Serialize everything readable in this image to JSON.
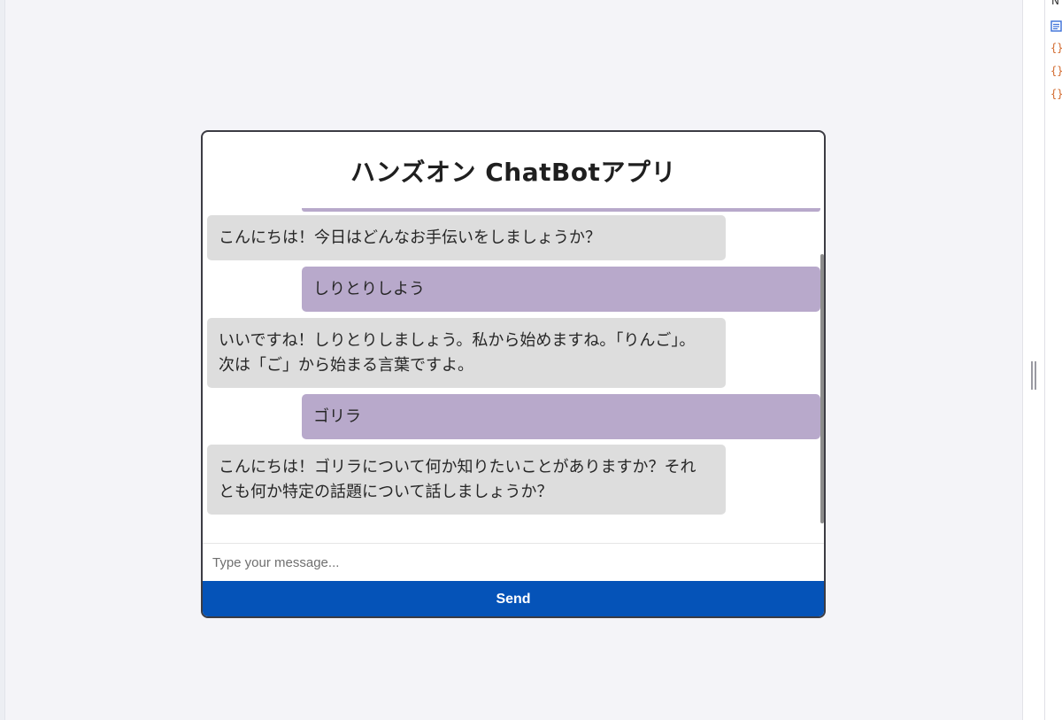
{
  "app": {
    "title": "ハンズオン ChatBotアプリ"
  },
  "messages": [
    {
      "role": "bot",
      "text": "こんにちは！今日はどんなお手伝いをしましょうか？"
    },
    {
      "role": "user",
      "text": "しりとりしよう"
    },
    {
      "role": "bot",
      "lines": [
        "いいですね！しりとりしましょう。私から始めますね。「りんご」。",
        "次は「ご」から始まる言葉ですよ。"
      ]
    },
    {
      "role": "user",
      "text": "ゴリラ"
    },
    {
      "role": "bot",
      "lines": [
        "こんにちは！ゴリラについて何か知りたいことがありますか？それ",
        "とも何か特定の話題について話しましょうか？"
      ]
    }
  ],
  "input": {
    "placeholder": "Type your message...",
    "value": ""
  },
  "send": {
    "label": "Send"
  },
  "devtools": {
    "header_fragment": "N"
  },
  "colors": {
    "bot_bubble": "#dddddd",
    "user_bubble": "#b8a9cb",
    "send_button": "#0553b8",
    "window_border": "#3c3c44"
  },
  "icons": [
    "document-icon",
    "json-brace-icon"
  ]
}
